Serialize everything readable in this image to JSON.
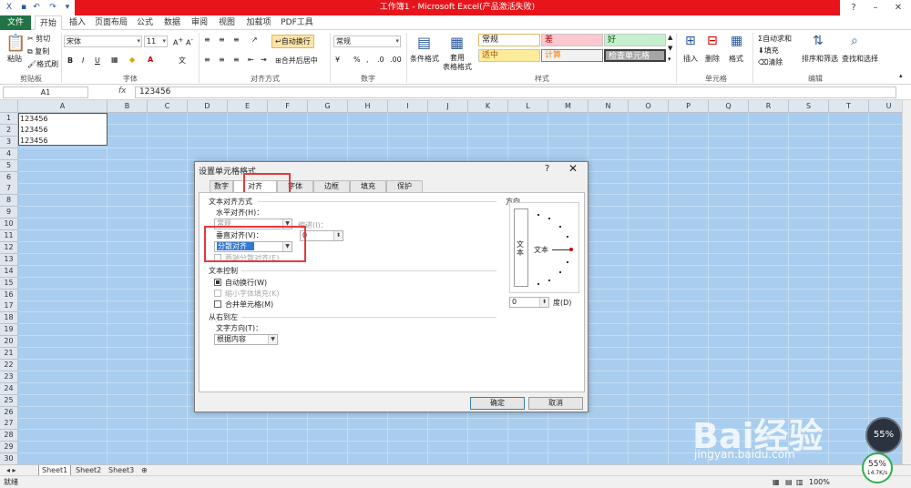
{
  "window": {
    "title": "工作簿1 - Microsoft Excel(产品激活失败)",
    "accent": "#217346",
    "title_color": "#e8141b"
  },
  "tabs": [
    "文件",
    "开始",
    "插入",
    "页面布局",
    "公式",
    "数据",
    "审阅",
    "视图",
    "加载项",
    "PDF工具"
  ],
  "ribbon": {
    "clipboard": {
      "paste": "粘贴",
      "cut": "剪切",
      "copy": "复制",
      "format_painter": "格式刷",
      "label": "剪贴板"
    },
    "font": {
      "name": "宋体",
      "size": "11",
      "bold": "B",
      "italic": "I",
      "underline": "U",
      "label": "字体"
    },
    "alignment": {
      "wrap": "自动换行",
      "merge": "合并后居中",
      "label": "对齐方式"
    },
    "number": {
      "format": "常规",
      "label": "数字"
    },
    "styles": {
      "conditional": "条件格式",
      "table": "套用\n表格格式",
      "cells": [
        "常规",
        "差",
        "好",
        "适中",
        "计算",
        "检查单元格"
      ],
      "label": "样式"
    },
    "cells_grp": {
      "insert": "插入",
      "delete": "删除",
      "format": "格式",
      "label": "单元格"
    },
    "editing": {
      "autosum": "自动求和",
      "fill": "填充",
      "clear": "清除",
      "sort": "排序和筛选",
      "find": "查找和选择",
      "label": "编辑"
    }
  },
  "formula_bar": {
    "name_box": "A1",
    "fx": "fx",
    "value": "123456"
  },
  "sheet": {
    "columns": [
      "A",
      "B",
      "C",
      "D",
      "E",
      "F",
      "G",
      "H",
      "I",
      "J",
      "K",
      "L",
      "M",
      "N",
      "O",
      "P",
      "Q",
      "R",
      "S",
      "T",
      "U"
    ],
    "rows": [
      "1",
      "2",
      "3",
      "4",
      "5",
      "6",
      "7",
      "8",
      "9",
      "10",
      "11",
      "12",
      "13",
      "14",
      "15",
      "16",
      "17",
      "18",
      "19",
      "20",
      "21",
      "22",
      "23",
      "24",
      "25",
      "26",
      "27",
      "28",
      "29",
      "30"
    ],
    "cell_lines": [
      "123456",
      "123456",
      "123456"
    ],
    "tabs": [
      "Sheet1",
      "Sheet2",
      "Sheet3"
    ]
  },
  "status": {
    "left": "就绪",
    "zoom": "100%"
  },
  "dialog": {
    "title": "设置单元格格式",
    "help": "?",
    "close": "✕",
    "tabs": [
      "数字",
      "对齐",
      "字体",
      "边框",
      "填充",
      "保护"
    ],
    "text_align_group": "文本对齐方式",
    "horizontal_label": "水平对齐(H)：",
    "horizontal_value": "常规",
    "indent_label": "缩进(I)：",
    "indent_value": "0",
    "vertical_label": "垂直对齐(V)：",
    "vertical_value": "分散对齐",
    "justify_distributed": "两端分散对齐(E)",
    "text_control_group": "文本控制",
    "wrap_text": "自动换行(W)",
    "shrink": "缩小字体填充(K)",
    "merge": "合并单元格(M)",
    "rtl_group": "从右到左",
    "direction_label": "文字方向(T)：",
    "direction_value": "根据内容",
    "orientation_group": "方向",
    "vertical_text": "文本",
    "orientation_text": "文本",
    "degree_value": "0",
    "degree_label": "度(D)",
    "ok": "确定",
    "cancel": "取消"
  },
  "watermark": {
    "brand": "Bai经验",
    "url": "jingyan.baidu.com"
  },
  "speed": {
    "percent": "55%",
    "rate": "14.7K/s"
  }
}
